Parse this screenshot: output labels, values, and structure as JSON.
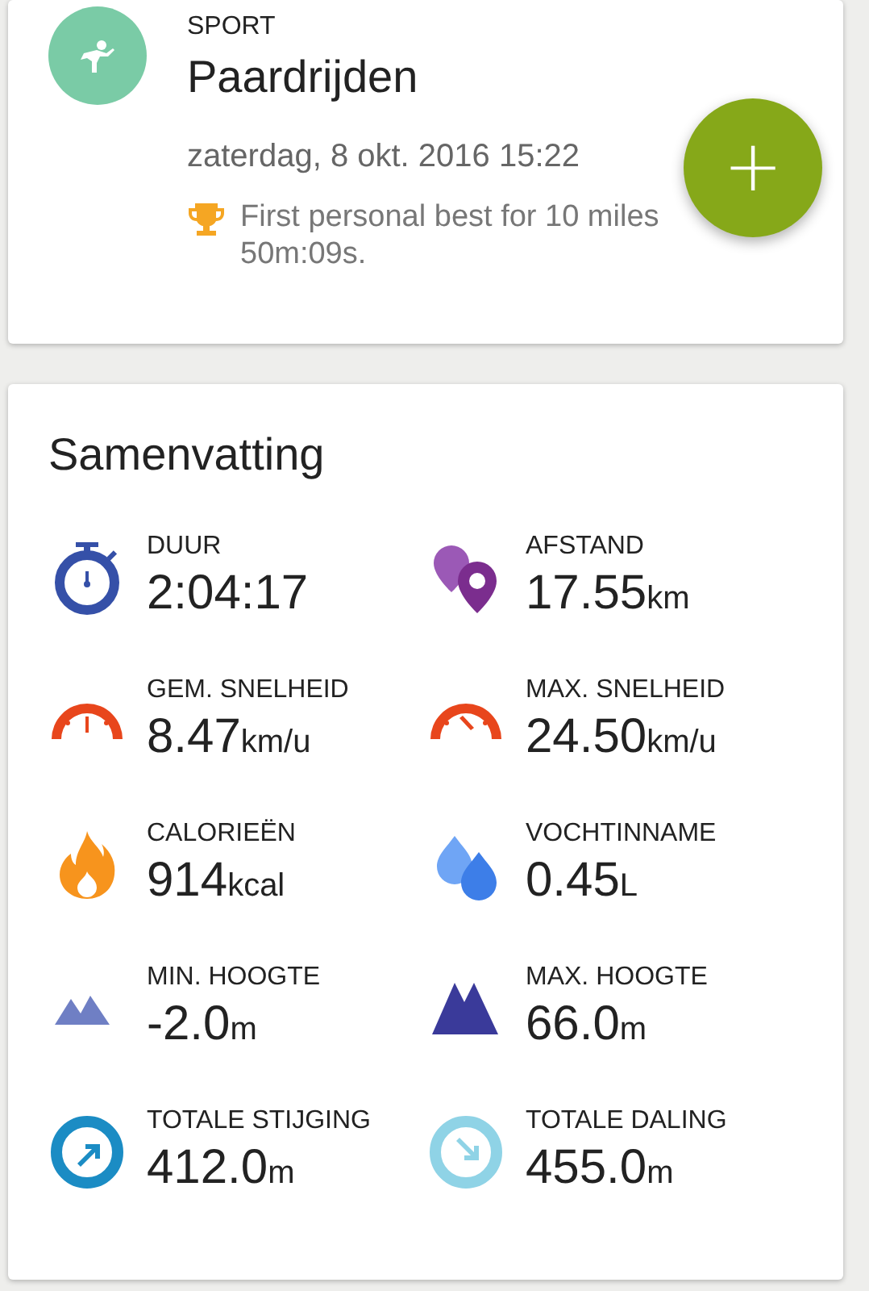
{
  "activity": {
    "category": "SPORT",
    "name": "Paardrijden",
    "date": "zaterdag, 8 okt. 2016 15:22",
    "achievement_lines": [
      "First personal best for 10 miles",
      "50m:09s."
    ]
  },
  "fab": {
    "label": "+"
  },
  "summary": {
    "title": "Samenvatting",
    "stats": [
      {
        "kind": "duration",
        "label": "DUUR",
        "value": "2:04:17"
      },
      {
        "kind": "distance",
        "label": "AFSTAND",
        "value": "17.55",
        "unit": "km"
      },
      {
        "kind": "avg_speed",
        "label": "GEM. SNELHEID",
        "value": "8.47",
        "unit": "km/u"
      },
      {
        "kind": "max_speed",
        "label": "MAX. SNELHEID",
        "value": "24.50",
        "unit": "km/u"
      },
      {
        "kind": "calories",
        "label": "CALORIEËN",
        "value": "914",
        "unit": "kcal"
      },
      {
        "kind": "water",
        "label": "VOCHTINNAME",
        "value": "0.45",
        "unit": "L"
      },
      {
        "kind": "min_altitude",
        "label": "MIN. HOOGTE",
        "value": "-2.0",
        "unit": "m"
      },
      {
        "kind": "max_altitude",
        "label": "MAX. HOOGTE",
        "value": "66.0",
        "unit": "m"
      },
      {
        "kind": "ascent",
        "label": "TOTALE STIJGING",
        "value": "412.0",
        "unit": "m"
      },
      {
        "kind": "descent",
        "label": "TOTALE DALING",
        "value": "455.0",
        "unit": "m"
      }
    ]
  }
}
